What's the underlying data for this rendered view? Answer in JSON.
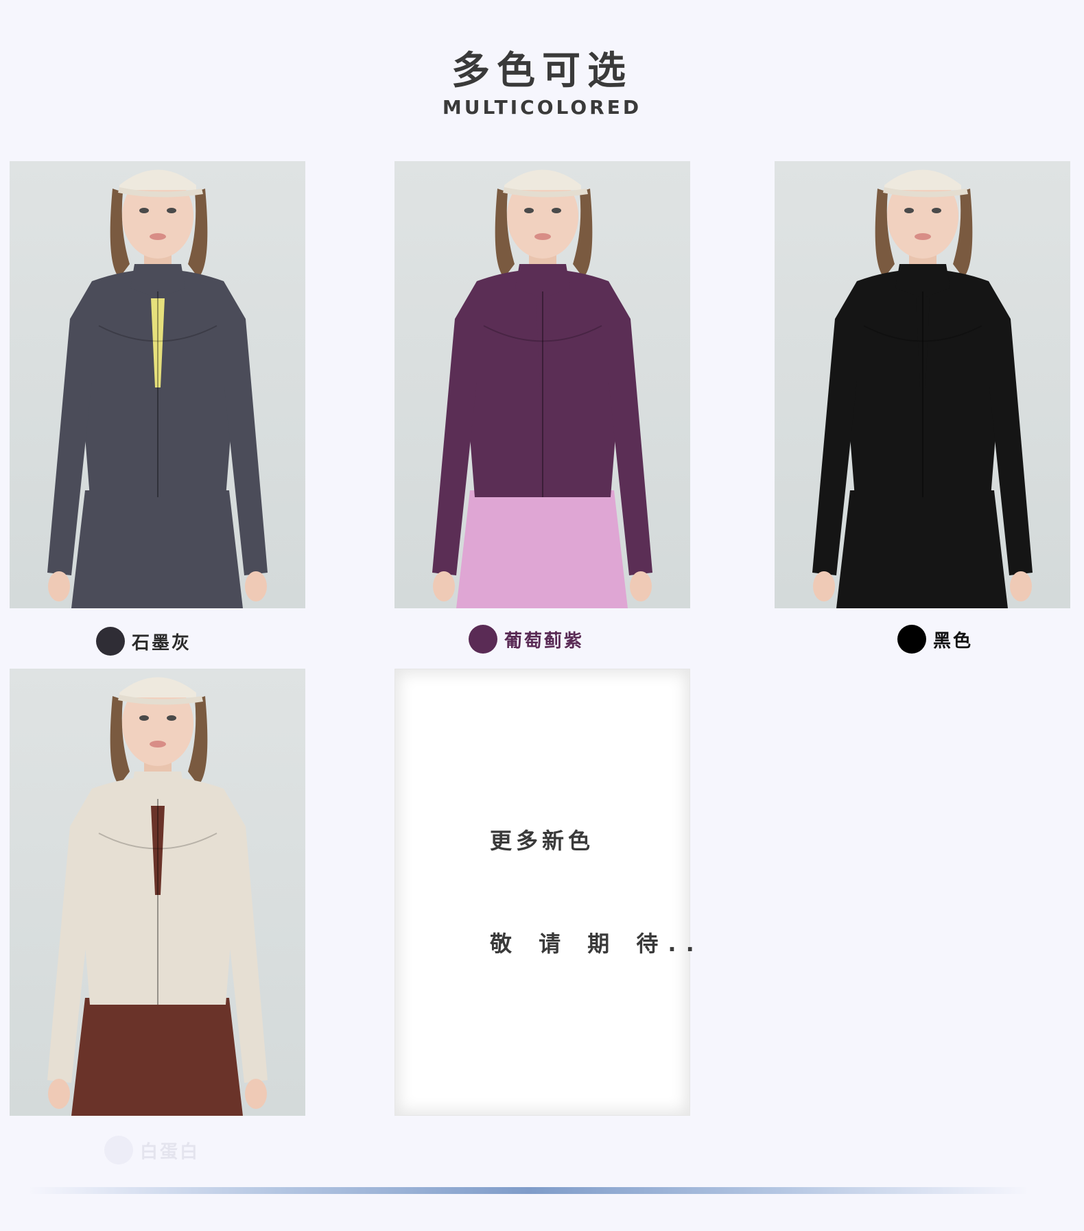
{
  "header": {
    "title": "多色可选",
    "subtitle": "MULTICOLORED"
  },
  "colors": [
    {
      "label": "石墨灰",
      "swatch": "#2f2d35",
      "jacket": "#4b4c59",
      "inner": "#e6e07c",
      "bottom": "#4b4c59",
      "label_color": "#2b2b2b"
    },
    {
      "label": "葡萄蓟紫",
      "swatch": "#5a2b55",
      "jacket": "#5b2e55",
      "inner": "#5b2e55",
      "bottom": "#dfa6d4",
      "label_color": "#5a2b55"
    },
    {
      "label": "黑色",
      "swatch": "#000000",
      "jacket": "#151515",
      "inner": "#151515",
      "bottom": "#151515",
      "label_color": "#111111"
    },
    {
      "label": "白蛋白",
      "swatch": "#ededf7",
      "jacket": "#e6dfd3",
      "inner": "#6a3329",
      "bottom": "#6a3329",
      "label_color": "#e4e4ee"
    }
  ],
  "coming_soon": {
    "line1": "更多新色",
    "line2": "敬 请 期 待.."
  }
}
